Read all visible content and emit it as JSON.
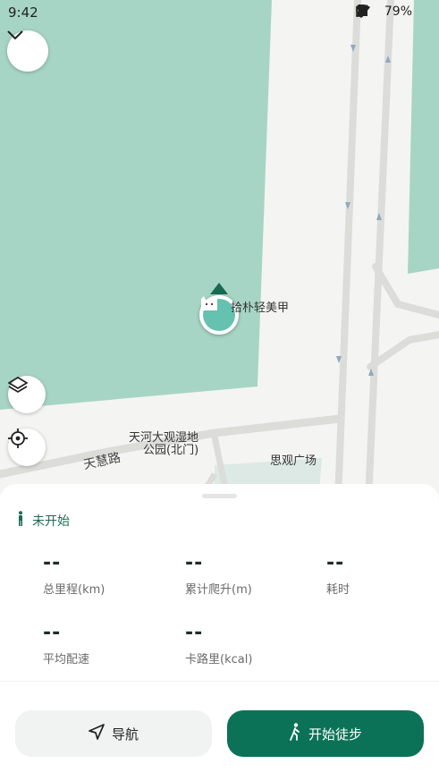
{
  "status_bar": {
    "time": "9:42",
    "battery": "79%"
  },
  "map": {
    "labels": {
      "shop": "拾朴轻美甲",
      "park_line1": "天河大观湿地",
      "park_line2": "公园(北门)",
      "plaza": "思观广场",
      "road": "天慧路"
    }
  },
  "sheet": {
    "status": "未开始",
    "stats": [
      {
        "value": "--",
        "label": "总里程(km)"
      },
      {
        "value": "--",
        "label": "累计爬升(m)"
      },
      {
        "value": "--",
        "label": "耗时"
      },
      {
        "value": "--",
        "label": "平均配速"
      },
      {
        "value": "--",
        "label": "卡路里(kcal)"
      }
    ],
    "nav_button": "导航",
    "start_button": "开始徒步"
  },
  "colors": {
    "accent": "#0c7257",
    "park_green": "#a7d5c5",
    "marker": "#65c1b0"
  }
}
